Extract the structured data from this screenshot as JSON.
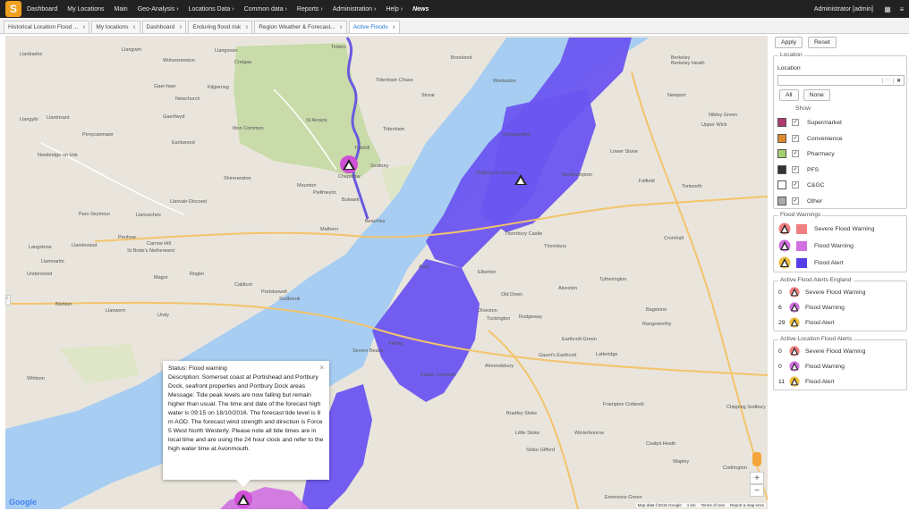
{
  "nav": {
    "items": [
      "Dashboard",
      "My Locations",
      "Main",
      "Geo-Analysis",
      "Locations Data",
      "Common data",
      "Reports",
      "Administration",
      "Help",
      "News"
    ],
    "user": "Administrator [admin]"
  },
  "tabs": [
    {
      "label": "Historical Location Flood ..."
    },
    {
      "label": "My locations"
    },
    {
      "label": "Dashboard"
    },
    {
      "label": "Enduring flood risk"
    },
    {
      "label": "Region Weather & Forecast..."
    },
    {
      "label": "Active Floods",
      "active": true
    }
  ],
  "tab_close": "x",
  "map": {
    "labels": [
      "Llangwm",
      "Wolvesnewton",
      "Llanbadoc",
      "Llangovan",
      "Creigau",
      "Tintern",
      "Tidenham Chase",
      "Brookend",
      "Berkeley",
      "Berkeley Heath",
      "Gaer-fawr",
      "Kilgwrrwg",
      "Newchurch",
      "St Arvans",
      "Stroat",
      "Woolaston",
      "Newport",
      "Llangybi",
      "Llantrisant",
      "Gaerllwyd",
      "Itton Common",
      "Tidenham",
      "Sheppardine",
      "Nibley Green",
      "Penycaemawr",
      "Earlswood",
      "Tutshill",
      "Sedbury",
      "Lower Stone",
      "Upper Wick",
      "Newbridge on Usk",
      "Shirenewton",
      "Mounton",
      "Pwllmeyric",
      "Chepstow",
      "Oldbury-on-Severn",
      "Rockhampton",
      "Falfield",
      "Tortworth",
      "Llanvair-Discoed",
      "Bulwark",
      "Parc-Seymour",
      "Llanvaches",
      "Beachley",
      "Thornbury Castle",
      "Thornbury",
      "Cromhall",
      "Penhow",
      "Carrow Hill",
      "Mathern",
      "Llanmartin",
      "Langstone",
      "Llandevaud",
      "St Bride's Netherwent",
      "Aust",
      "Elberton",
      "Underwood",
      "Magor",
      "Rogiet",
      "Undy",
      "Caldicot",
      "Portskewett",
      "Sudbrook",
      "Olveston",
      "Old Down",
      "Tytherington",
      "Alveston",
      "Bishton",
      "Llanwern",
      "Tockington",
      "Rudgeway",
      "Bagstone",
      "Rangeworthy",
      "Severn Beach",
      "Pilning",
      "Earthcott Green",
      "Almondsbury",
      "Gaunt's Earthcott",
      "Latteridge",
      "Whitson",
      "Easter Compton",
      "Bradley Stoke",
      "Frampton Cotterell",
      "Chipping Sodbury",
      "Little Stoke",
      "Winterbourne",
      "Stoke Gifford",
      "Wapley",
      "Coalpit Heath",
      "Codrington",
      "Emersons Green"
    ],
    "popup": {
      "status": "Status: Flood warning",
      "description": "Description: Somerset coast at Portishead and Portbury Dock, seafront properties and Portbury Dock areas",
      "message": "Message: Tide peak levels are now falling but remain higher than usual. The time and date of the forecast high water is 09:15 on 18/10/2016. The forecast tide level is 8 m AOD. The forecast wind strength and direction is Force 5 West North Westerly. Please note all tide times are in local time and are using the 24 hour clock and refer to the high water time at Avonmouth.",
      "close": "×"
    },
    "google": "Google",
    "footer": [
      "Map data ©2016 Google",
      "1 km",
      "Terms of Use",
      "Report a map error"
    ],
    "zoom_in": "+",
    "zoom_out": "−",
    "expand_tab": "›"
  },
  "panel": {
    "apply": "Apply",
    "reset": "Reset",
    "location_legend": "Location",
    "location_label": "Location",
    "input_dots": "···",
    "input_clear": "✖",
    "all": "All",
    "none": "None",
    "show": "Show",
    "check_mark": "✓",
    "show_items": [
      {
        "label": "Supermarket",
        "color": "#b03a70"
      },
      {
        "label": "Convenience",
        "color": "#e08a2c"
      },
      {
        "label": "Pharmacy",
        "color": "#a4cf6e"
      },
      {
        "label": "PFS",
        "color": "#333333"
      },
      {
        "label": "C&GC",
        "color": "#ffffff"
      },
      {
        "label": "Other",
        "color": "#aaaaaa"
      }
    ],
    "flood_warnings_legend": "Flood Warnings",
    "flood_warnings": [
      {
        "label": "Severe Flood Warning",
        "color": "#f08080"
      },
      {
        "label": "Flood Warning",
        "color": "#d070e0"
      },
      {
        "label": "Flood Alert",
        "color": "#5540e8"
      }
    ],
    "england_legend": "Active Flood Alerts England",
    "england": [
      {
        "count": "0",
        "label": "Severe Flood Warning"
      },
      {
        "count": "6",
        "label": "Flood Warning"
      },
      {
        "count": "29",
        "label": "Flood Alert"
      }
    ],
    "location_alerts_legend": "Active Location Flood Alerts",
    "location_alerts": [
      {
        "count": "0",
        "label": "Severe Flood Warning"
      },
      {
        "count": "0",
        "label": "Flood Warning"
      },
      {
        "count": "11",
        "label": "Flood Alert"
      }
    ]
  }
}
